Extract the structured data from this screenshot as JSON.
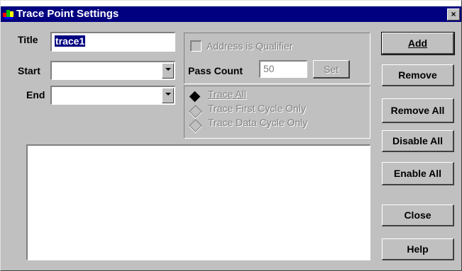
{
  "window": {
    "title": "Trace Point Settings",
    "close_glyph": "×"
  },
  "form": {
    "title_label": "Title",
    "title_value": "trace1",
    "start_label": "Start",
    "start_value": "",
    "end_label": "End",
    "end_value": ""
  },
  "qualifier": {
    "address_label": "Address is Qualifier",
    "pass_count_label": "Pass Count",
    "pass_count_value": "50",
    "set_label": "Set"
  },
  "trace_options": [
    {
      "label": "Trace All",
      "selected": true,
      "enabled": true
    },
    {
      "label": "Trace First Cycle Only",
      "selected": false,
      "enabled": false
    },
    {
      "label": "Trace Data Cycle Only",
      "selected": false,
      "enabled": false
    }
  ],
  "buttons": {
    "add": "Add",
    "remove": "Remove",
    "remove_all": "Remove All",
    "disable_all": "Disable All",
    "enable_all": "Enable All",
    "close": "Close",
    "help": "Help"
  },
  "colors": {
    "titlebar": "#000080",
    "face": "#c0c0c0",
    "selection": "#000080"
  },
  "icons": {
    "app": "app-icon",
    "close": "close-icon",
    "dropdown": "chevron-down-icon"
  }
}
